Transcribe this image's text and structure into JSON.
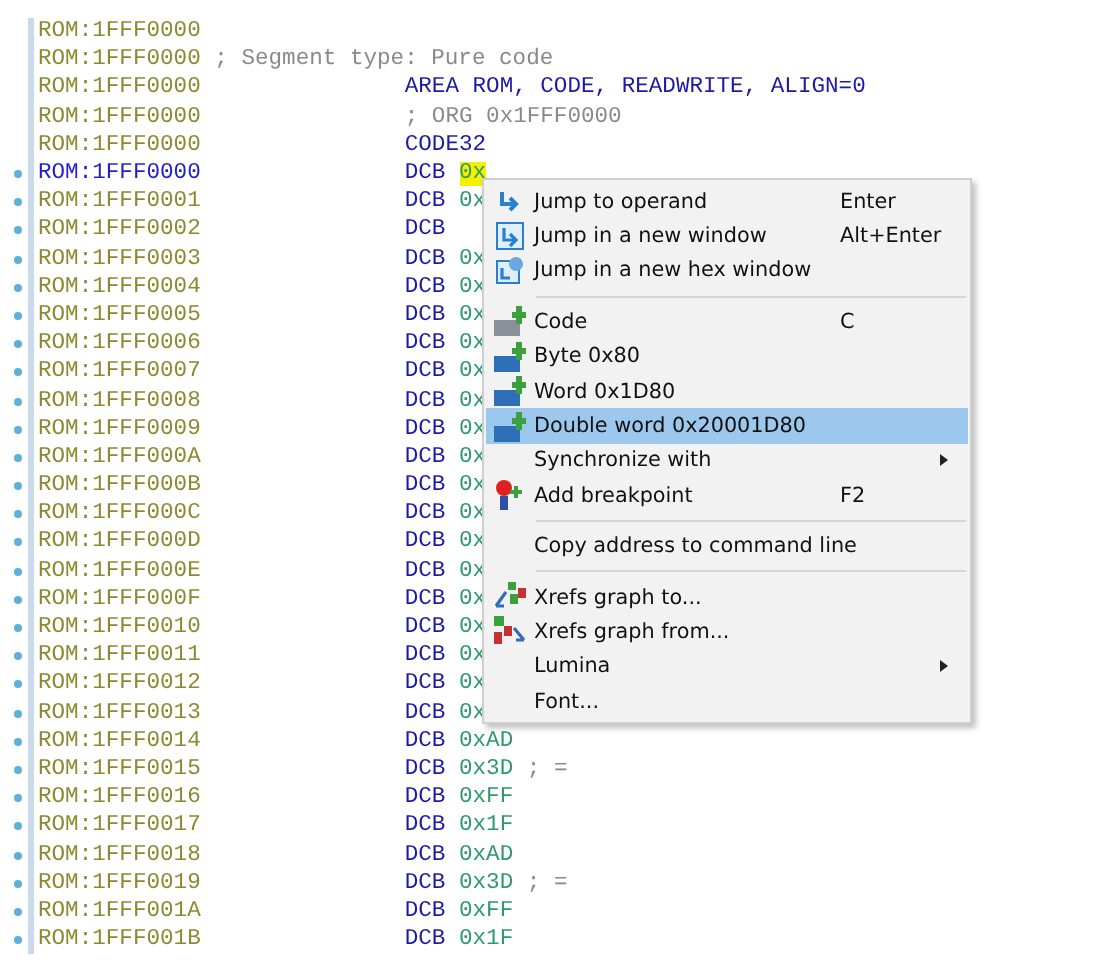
{
  "listing": [
    {
      "address": "ROM:1FFF0000",
      "current": false,
      "bullet": false,
      "kind": "blank"
    },
    {
      "address": "ROM:1FFF0000",
      "current": false,
      "bullet": false,
      "kind": "comment",
      "text": "; Segment type: Pure code"
    },
    {
      "address": "ROM:1FFF0000",
      "current": false,
      "bullet": false,
      "kind": "directive",
      "text": "AREA ROM, CODE, READWRITE, ALIGN=0"
    },
    {
      "address": "ROM:1FFF0000",
      "current": false,
      "bullet": false,
      "kind": "note",
      "text": "; ORG 0x1FFF0000"
    },
    {
      "address": "ROM:1FFF0000",
      "current": false,
      "bullet": false,
      "kind": "directive",
      "text": "CODE32"
    },
    {
      "address": "ROM:1FFF0000",
      "current": true,
      "bullet": true,
      "kind": "data",
      "mnemonic": "DCB",
      "operand": "0x",
      "highlighted": true
    },
    {
      "address": "ROM:1FFF0001",
      "current": false,
      "bullet": true,
      "kind": "data",
      "mnemonic": "DCB",
      "operand": "0x",
      "highlighted": false
    },
    {
      "address": "ROM:1FFF0002",
      "current": false,
      "bullet": true,
      "kind": "data",
      "mnemonic": "DCB",
      "highlighted": false
    },
    {
      "address": "ROM:1FFF0003",
      "current": false,
      "bullet": true,
      "kind": "data",
      "mnemonic": "DCB",
      "operand": "0x",
      "highlighted": false
    },
    {
      "address": "ROM:1FFF0004",
      "current": false,
      "bullet": true,
      "kind": "data",
      "mnemonic": "DCB",
      "operand": "0x",
      "highlighted": false
    },
    {
      "address": "ROM:1FFF0005",
      "current": false,
      "bullet": true,
      "kind": "data",
      "mnemonic": "DCB",
      "operand": "0x",
      "highlighted": false
    },
    {
      "address": "ROM:1FFF0006",
      "current": false,
      "bullet": true,
      "kind": "data",
      "mnemonic": "DCB",
      "operand": "0x",
      "highlighted": false
    },
    {
      "address": "ROM:1FFF0007",
      "current": false,
      "bullet": true,
      "kind": "data",
      "mnemonic": "DCB",
      "operand": "0x",
      "highlighted": false
    },
    {
      "address": "ROM:1FFF0008",
      "current": false,
      "bullet": true,
      "kind": "data",
      "mnemonic": "DCB",
      "operand": "0x",
      "highlighted": false
    },
    {
      "address": "ROM:1FFF0009",
      "current": false,
      "bullet": true,
      "kind": "data",
      "mnemonic": "DCB",
      "operand": "0x",
      "highlighted": false
    },
    {
      "address": "ROM:1FFF000A",
      "current": false,
      "bullet": true,
      "kind": "data",
      "mnemonic": "DCB",
      "operand": "0x",
      "highlighted": false
    },
    {
      "address": "ROM:1FFF000B",
      "current": false,
      "bullet": true,
      "kind": "data",
      "mnemonic": "DCB",
      "operand": "0x",
      "highlighted": false
    },
    {
      "address": "ROM:1FFF000C",
      "current": false,
      "bullet": true,
      "kind": "data",
      "mnemonic": "DCB",
      "operand": "0x",
      "highlighted": false
    },
    {
      "address": "ROM:1FFF000D",
      "current": false,
      "bullet": true,
      "kind": "data",
      "mnemonic": "DCB",
      "operand": "0x",
      "highlighted": false
    },
    {
      "address": "ROM:1FFF000E",
      "current": false,
      "bullet": true,
      "kind": "data",
      "mnemonic": "DCB",
      "operand": "0x",
      "highlighted": false
    },
    {
      "address": "ROM:1FFF000F",
      "current": false,
      "bullet": true,
      "kind": "data",
      "mnemonic": "DCB",
      "operand": "0x",
      "highlighted": false
    },
    {
      "address": "ROM:1FFF0010",
      "current": false,
      "bullet": true,
      "kind": "data",
      "mnemonic": "DCB",
      "operand": "0x",
      "highlighted": false
    },
    {
      "address": "ROM:1FFF0011",
      "current": false,
      "bullet": true,
      "kind": "data",
      "mnemonic": "DCB",
      "operand": "0x",
      "highlighted": false
    },
    {
      "address": "ROM:1FFF0012",
      "current": false,
      "bullet": true,
      "kind": "data",
      "mnemonic": "DCB",
      "operand": "0x",
      "highlighted": false
    },
    {
      "address": "ROM:1FFF0013",
      "current": false,
      "bullet": true,
      "kind": "data",
      "mnemonic": "DCB",
      "operand": "0x",
      "highlighted": false
    },
    {
      "address": "ROM:1FFF0014",
      "current": false,
      "bullet": true,
      "kind": "data",
      "mnemonic": "DCB",
      "operand": "0xAD",
      "highlighted": false
    },
    {
      "address": "ROM:1FFF0015",
      "current": false,
      "bullet": true,
      "kind": "data",
      "mnemonic": "DCB",
      "operand": "0x3D",
      "comment": "; =",
      "highlighted": false
    },
    {
      "address": "ROM:1FFF0016",
      "current": false,
      "bullet": true,
      "kind": "data",
      "mnemonic": "DCB",
      "operand": "0xFF",
      "highlighted": false
    },
    {
      "address": "ROM:1FFF0017",
      "current": false,
      "bullet": true,
      "kind": "data",
      "mnemonic": "DCB",
      "operand": "0x1F",
      "highlighted": false
    },
    {
      "address": "ROM:1FFF0018",
      "current": false,
      "bullet": true,
      "kind": "data",
      "mnemonic": "DCB",
      "operand": "0xAD",
      "highlighted": false
    },
    {
      "address": "ROM:1FFF0019",
      "current": false,
      "bullet": true,
      "kind": "data",
      "mnemonic": "DCB",
      "operand": "0x3D",
      "comment": "; =",
      "highlighted": false
    },
    {
      "address": "ROM:1FFF001A",
      "current": false,
      "bullet": true,
      "kind": "data",
      "mnemonic": "DCB",
      "operand": "0xFF",
      "highlighted": false
    },
    {
      "address": "ROM:1FFF001B",
      "current": false,
      "bullet": true,
      "kind": "data",
      "mnemonic": "DCB",
      "operand": "0x1F",
      "highlighted": false
    }
  ],
  "context_menu": [
    {
      "kind": "item",
      "label": "Jump to operand",
      "shortcut": "Enter",
      "submenu": false,
      "selected": false
    },
    {
      "kind": "item",
      "label": "Jump in a new window",
      "shortcut": "Alt+Enter",
      "submenu": false,
      "selected": false
    },
    {
      "kind": "item",
      "label": "Jump in a new hex window",
      "submenu": false,
      "selected": false
    },
    {
      "kind": "separator"
    },
    {
      "kind": "item",
      "label": "Code",
      "shortcut": "C",
      "submenu": false,
      "selected": false
    },
    {
      "kind": "item",
      "label": "Byte 0x80",
      "submenu": false,
      "selected": false
    },
    {
      "kind": "item",
      "label": "Word 0x1D80",
      "submenu": false,
      "selected": false
    },
    {
      "kind": "item",
      "label": "Double word 0x20001D80",
      "submenu": false,
      "selected": true
    },
    {
      "kind": "item",
      "label": "Synchronize with",
      "submenu": true,
      "selected": false
    },
    {
      "kind": "item",
      "label": "Add breakpoint",
      "shortcut": "F2",
      "submenu": false,
      "selected": false
    },
    {
      "kind": "separator"
    },
    {
      "kind": "item",
      "label": "Copy address to command line",
      "submenu": false,
      "selected": false
    },
    {
      "kind": "separator"
    },
    {
      "kind": "item",
      "label": "Xrefs graph to...",
      "submenu": false,
      "selected": false
    },
    {
      "kind": "item",
      "label": "Xrefs graph from...",
      "submenu": false,
      "selected": false
    },
    {
      "kind": "item",
      "label": "Lumina",
      "submenu": true,
      "selected": false
    },
    {
      "kind": "item",
      "label": "Font...",
      "submenu": false,
      "selected": false
    }
  ]
}
